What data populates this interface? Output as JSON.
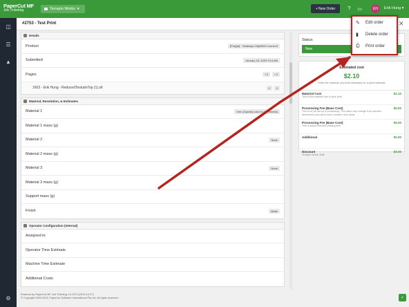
{
  "app": {
    "brand_title": "PaperCut MF",
    "brand_sub": "Job Ticketing",
    "org": "Terrapin Works"
  },
  "topbar": {
    "new_order": "+ New Order",
    "help_icon": "help-icon",
    "chat_icon": "chat-icon",
    "bell_icon": "bell-icon",
    "avatar_initials": "EH",
    "username": "Erik Hung ▾"
  },
  "order": {
    "title": "#2753  -  Test Print"
  },
  "details": {
    "heading": "Details",
    "product_label": "Product",
    "product_value": "[Polyjet] - Stratasys Objet500 Connex3",
    "submitted_label": "Submitted",
    "submitted_value": "January 18, 2020 9:14 AM",
    "pages_label": "Pages",
    "pages_a": "0",
    "pages_b": "0",
    "file_name": "1602 - Erik Hung - ReducedTestudoTop (1).stl",
    "file_a": "0",
    "file_b": "0"
  },
  "material": {
    "heading": "Material, Resolution, & Estimates",
    "rows": [
      {
        "label": "Material 1",
        "value": "Vero (Specify color in Comments)"
      },
      {
        "label": "Material 1 mass (g)",
        "value": ""
      },
      {
        "label": "Material 2",
        "value": "None"
      },
      {
        "label": "Material 2 mass (g)",
        "value": ""
      },
      {
        "label": "Material 3",
        "value": "None"
      },
      {
        "label": "Material 3 mass (g)",
        "value": ""
      },
      {
        "label": "Support mass (g)",
        "value": ""
      },
      {
        "label": "Finish",
        "value": "Matte"
      }
    ]
  },
  "operator": {
    "heading": "Operator Configuration (Internal)",
    "rows": [
      {
        "label": "Assigned to"
      },
      {
        "label": "Operator Time Estimate"
      },
      {
        "label": "Machine Time Estimate"
      },
      {
        "label": "Additional Costs"
      }
    ]
  },
  "status": {
    "label": "Status",
    "value": "New"
  },
  "cost": {
    "title": "Estimated cost",
    "value": "$2.10",
    "note": "Enter the material, and time estimates for a price estimate",
    "lines": [
      {
        "title": "Material Cost",
        "sub": "This is the material cost of your print.",
        "amount": "$2.10"
      },
      {
        "title": "Processing Fee (Base Cost)",
        "sub": "This is for job set up & processing. This value may change if an operator determines your job is more complex than usual.",
        "amount": "$0.00"
      },
      {
        "title": "Processing Fee (Base Cost)",
        "sub": "This is actual machine printing time",
        "amount": "$0.00"
      },
      {
        "title": "Additional",
        "sub": "",
        "amount": "$0.00"
      },
      {
        "title": "Discount",
        "sub": "Terrapin Works Staff",
        "amount": "$0.00"
      }
    ]
  },
  "menu": {
    "edit": "Edit order",
    "delete": "Delete order",
    "print": "Print order"
  },
  "footer": {
    "line1": "Powered by PaperCut MF Job Ticketing 1.0.2974 (2019-10-27)",
    "line2": "© Copyright 1999-2019, PaperCut Software International Pty Ltd. All rights reserved."
  },
  "colors": {
    "brand_green": "#3a9a3a",
    "annotation_red": "#b5241f",
    "sidebar": "#1f2833"
  }
}
